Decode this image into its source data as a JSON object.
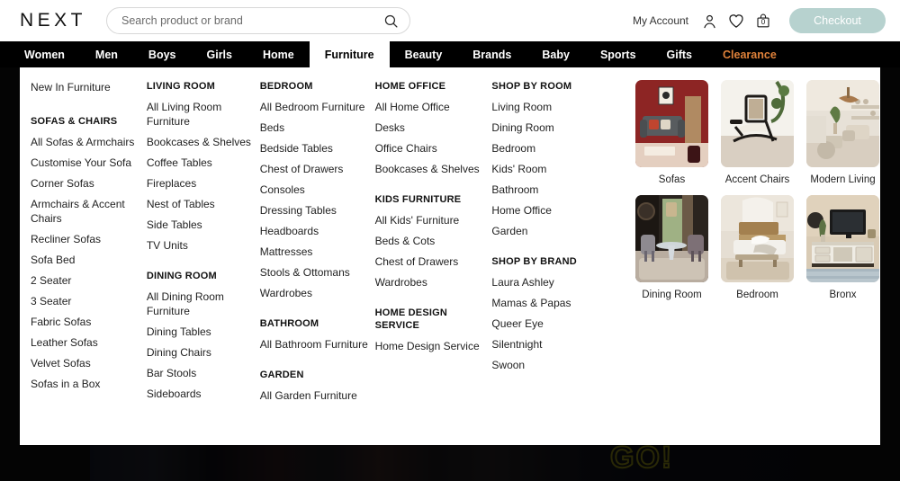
{
  "header": {
    "logo": "NEXT",
    "search": {
      "placeholder": "Search product or brand",
      "value": "",
      "icon": "search-icon"
    },
    "my_account": "My Account",
    "account_icon": "user-icon",
    "wishlist_icon": "heart-icon",
    "bag_icon": "shopping-bag-icon",
    "bag_count": "0",
    "checkout": "Checkout",
    "checkout_color": "#b7d2cf"
  },
  "nav": {
    "items": [
      {
        "label": "Women",
        "active": false,
        "highlight": false
      },
      {
        "label": "Men",
        "active": false,
        "highlight": false
      },
      {
        "label": "Boys",
        "active": false,
        "highlight": false
      },
      {
        "label": "Girls",
        "active": false,
        "highlight": false
      },
      {
        "label": "Home",
        "active": false,
        "highlight": false
      },
      {
        "label": "Furniture",
        "active": true,
        "highlight": false
      },
      {
        "label": "Beauty",
        "active": false,
        "highlight": false
      },
      {
        "label": "Brands",
        "active": false,
        "highlight": false
      },
      {
        "label": "Baby",
        "active": false,
        "highlight": false
      },
      {
        "label": "Sports",
        "active": false,
        "highlight": false
      },
      {
        "label": "Gifts",
        "active": false,
        "highlight": false
      },
      {
        "label": "Clearance",
        "active": false,
        "highlight": true,
        "color": "#e0823a"
      }
    ]
  },
  "mega_menu": {
    "col1": {
      "top_link": "New In Furniture",
      "groups": [
        {
          "title": "SOFAS & CHAIRS",
          "links": [
            "All Sofas & Armchairs",
            "Customise Your Sofa",
            "Corner Sofas",
            "Armchairs & Accent Chairs",
            "Recliner Sofas",
            "Sofa Bed",
            "2 Seater",
            "3 Seater",
            "Fabric Sofas",
            "Leather Sofas",
            "Velvet Sofas",
            "Sofas in a Box"
          ]
        }
      ]
    },
    "col2": {
      "groups": [
        {
          "title": "LIVING ROOM",
          "links": [
            "All Living Room Furniture",
            "Bookcases & Shelves",
            "Coffee Tables",
            "Fireplaces",
            "Nest of Tables",
            "Side Tables",
            "TV Units"
          ]
        },
        {
          "title": "DINING ROOM",
          "links": [
            "All Dining Room Furniture",
            "Dining Tables",
            "Dining Chairs",
            "Bar Stools",
            "Sideboards"
          ]
        }
      ]
    },
    "col3": {
      "groups": [
        {
          "title": "BEDROOM",
          "links": [
            "All Bedroom Furniture",
            "Beds",
            "Bedside Tables",
            "Chest of Drawers",
            "Consoles",
            "Dressing Tables",
            "Headboards",
            "Mattresses",
            "Stools & Ottomans",
            "Wardrobes"
          ]
        },
        {
          "title": "BATHROOM",
          "links": [
            "All Bathroom Furniture"
          ]
        },
        {
          "title": "GARDEN",
          "links": [
            "All Garden Furniture"
          ]
        }
      ]
    },
    "col4": {
      "groups": [
        {
          "title": "HOME OFFICE",
          "links": [
            "All Home Office",
            "Desks",
            "Office Chairs",
            "Bookcases & Shelves"
          ]
        },
        {
          "title": "KIDS FURNITURE",
          "links": [
            "All Kids' Furniture",
            "Beds & Cots",
            "Chest of Drawers",
            "Wardrobes"
          ]
        },
        {
          "title": "HOME DESIGN SERVICE",
          "links": [
            "Home Design Service"
          ]
        }
      ]
    },
    "col5": {
      "groups": [
        {
          "title": "SHOP BY ROOM",
          "links": [
            "Living Room",
            "Dining Room",
            "Bedroom",
            "Kids' Room",
            "Bathroom",
            "Home Office",
            "Garden"
          ]
        },
        {
          "title": "SHOP BY BRAND",
          "links": [
            "Laura Ashley",
            "Mamas & Papas",
            "Queer Eye",
            "Silentnight",
            "Swoon"
          ]
        }
      ]
    },
    "tiles": [
      {
        "label": "Sofas",
        "image": "red-living-room-with-grey-sofa"
      },
      {
        "label": "Accent Chairs",
        "image": "black-rattan-rocking-chair"
      },
      {
        "label": "Modern Living",
        "image": "neutral-modern-living-room"
      },
      {
        "label": "Dining Room",
        "image": "dark-dining-room-glass-table"
      },
      {
        "label": "Bedroom",
        "image": "wooden-bed-neutral-bedroom"
      },
      {
        "label": "Bronx",
        "image": "tv-unit-with-television"
      }
    ]
  },
  "hero": {
    "text": "GO!",
    "text_color": "#6d6a12"
  }
}
